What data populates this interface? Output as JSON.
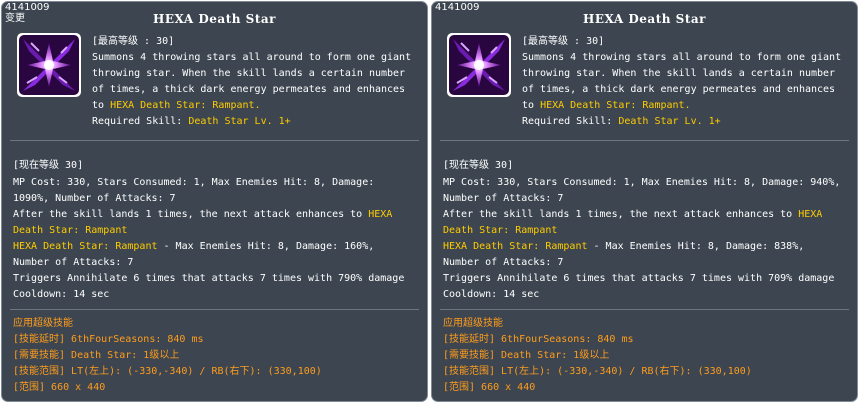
{
  "panels": [
    {
      "id": "4141009",
      "tag": "变更",
      "title": "HEXA Death Star",
      "max_level": "[最高等级 : 30]",
      "desc_line1": "Summons 4 throwing stars all around to form one giant",
      "desc_line2": "throwing star. When the skill lands a certain number",
      "desc_line3": "of times, a thick dark energy permeates and enhances",
      "desc_line4_pre": "to ",
      "desc_line4_hl": "HEXA Death Star: Rampant.",
      "req_label": "Required Skill: ",
      "req_value": "Death Star Lv. 1+",
      "current_level": "[现在等级 30]",
      "stats_line1": "MP Cost: 330, Stars Consumed: 1, Max Enemies Hit: 8, Damage:",
      "stats_line2": "1090%, Number of Attacks: 7",
      "after_pre": "After the skill lands 1 times, the next attack enhances to ",
      "after_hl1": "HEXA",
      "after_hl2": "Death Star: Rampant",
      "rampant_hl": "HEXA Death Star: Rampant",
      "rampant_rest": " - Max Enemies Hit: 8, Damage: 160%,",
      "rampant_line2": "Number of Attacks: 7",
      "triggers": "Triggers Annihilate 6 times that attacks 7 times with 790% damage",
      "cooldown": "Cooldown: 14 sec",
      "hyper_title": "应用超级技能",
      "hyper_delay": "[技能延时] 6thFourSeasons: 840 ms",
      "hyper_req": "[需要技能] Death Star: 1级以上",
      "hyper_range": "[技能范围] LT(左上): (-330,-340) / RB(右下): (330,100)",
      "hyper_area": "[范围] 660 x 440"
    },
    {
      "id": "4141009",
      "tag": "",
      "title": "HEXA Death Star",
      "max_level": "[最高等级 : 30]",
      "desc_line1": "Summons 4 throwing stars all around to form one giant",
      "desc_line2": "throwing star. When the skill lands a certain number",
      "desc_line3": "of times, a thick dark energy permeates and enhances",
      "desc_line4_pre": "to ",
      "desc_line4_hl": "HEXA Death Star: Rampant.",
      "req_label": "Required Skill: ",
      "req_value": "Death Star Lv. 1+",
      "current_level": "[现在等级 30]",
      "stats_line1": "MP Cost: 330, Stars Consumed: 1, Max Enemies Hit: 8, Damage: 940%,",
      "stats_line2": "Number of Attacks: 7",
      "after_pre": "After the skill lands 1 times, the next attack enhances to ",
      "after_hl1": "HEXA",
      "after_hl2": "Death Star: Rampant",
      "rampant_hl": "HEXA Death Star: Rampant",
      "rampant_rest": " - Max Enemies Hit: 8, Damage: 838%,",
      "rampant_line2": "Number of Attacks: 7",
      "triggers": "Triggers Annihilate 6 times that attacks 7 times with 709% damage",
      "cooldown": "Cooldown: 14 sec",
      "hyper_title": "应用超级技能",
      "hyper_delay": "[技能延时] 6thFourSeasons: 840 ms",
      "hyper_req": "[需要技能] Death Star: 1级以上",
      "hyper_range": "[技能范围] LT(左上): (-330,-340) / RB(右下): (330,100)",
      "hyper_area": "[范围] 660 x 440"
    }
  ],
  "colors": {
    "background": "#3c4550",
    "highlight": "#ffcc00",
    "hyper": "#ff9d1c",
    "text": "#ffffff"
  },
  "icon": "hexa-death-star-skill-icon"
}
